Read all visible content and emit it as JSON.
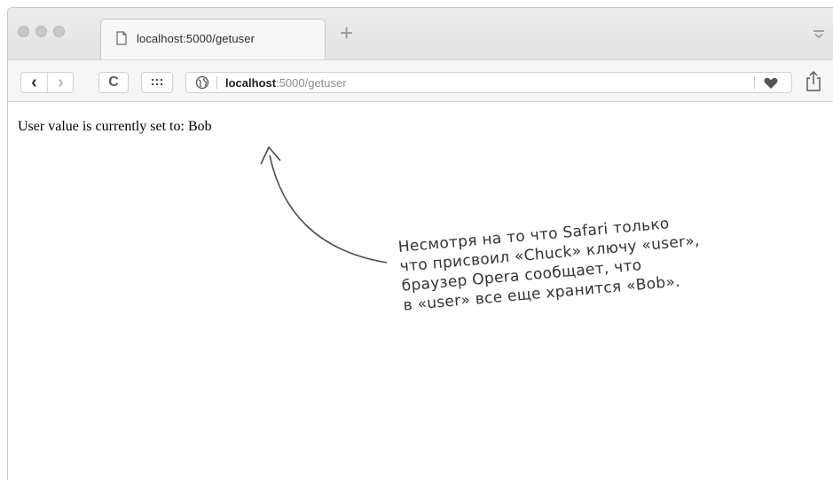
{
  "browser": {
    "tab": {
      "title": "localhost:5000/getuser"
    },
    "new_tab_label": "+",
    "toolbar": {
      "back_label": "‹",
      "forward_label": "›",
      "reload_label": "C"
    },
    "address": {
      "host": "localhost",
      "path": ":5000/getuser"
    }
  },
  "page": {
    "body_text": "User value is currently set to: Bob"
  },
  "annotation": {
    "lines": [
      "Несмотря на то что Safari только",
      "что присвоил «Chuck» ключу «user»,",
      "браузер Opera сообщает, что",
      "в «user» все еще хранится «Bob»."
    ]
  },
  "colors": {
    "traffic_light": "#c8c8c8",
    "heart": "#555555",
    "annotation_ink": "#333333"
  },
  "icons": [
    "page-icon",
    "menu-icon",
    "back-icon",
    "forward-icon",
    "reload-icon",
    "apps-grid-icon",
    "globe-icon",
    "heart-icon",
    "share-icon",
    "curved-arrow-icon"
  ]
}
